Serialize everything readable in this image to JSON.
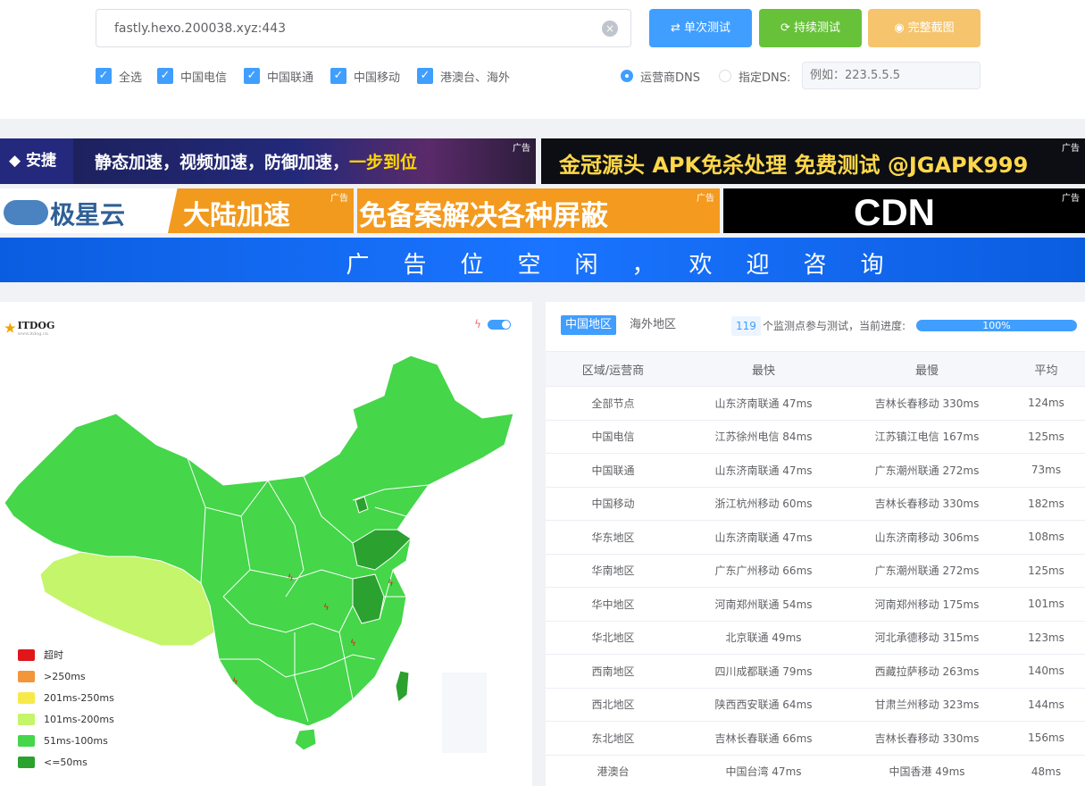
{
  "toolbar": {
    "url_value": "fastly.hexo.200038.xyz:443",
    "btn_single": "单次测试",
    "btn_continuous": "持续测试",
    "btn_screenshot": "完整截图"
  },
  "filters": {
    "all": "全选",
    "telecom": "中国电信",
    "unicom": "中国联通",
    "mobile": "中国移动",
    "overseas": "港澳台、海外"
  },
  "dns": {
    "isp_label": "运营商DNS",
    "custom_label": "指定DNS:",
    "placeholder": "例如：223.5.5.5"
  },
  "ads": {
    "tag": "广告",
    "ad1_logo": "安捷",
    "ad1_text": "静态加速，视频加速，防御加速，",
    "ad1_highlight": "一步到位",
    "ad2_text": "金冠源头 APK免杀处理 免费测试 @JGAPK999",
    "ad3_brand": "极星云",
    "ad3_text": "大陆加速",
    "ad4_text": "免备案解决各种屏蔽",
    "ad5_text": "CDN",
    "ad6_text": "广告位空闲，欢迎咨询"
  },
  "map": {
    "logo": "ITDOG",
    "logo_sub": "www.itdog.cn",
    "legend": [
      {
        "label": "超时",
        "color": "#e0161b"
      },
      {
        "label": ">250ms",
        "color": "#f3953a"
      },
      {
        "label": "201ms-250ms",
        "color": "#f8e94b"
      },
      {
        "label": "101ms-200ms",
        "color": "#c4f56a"
      },
      {
        "label": "51ms-100ms",
        "color": "#45d64a"
      },
      {
        "label": "<=50ms",
        "color": "#2ba12f"
      }
    ]
  },
  "results": {
    "tab_cn": "中国地区",
    "tab_overseas": "海外地区",
    "count": "119",
    "count_text": "个监测点参与测试，当前进度:",
    "progress": "100%",
    "headers": [
      "区域/运营商",
      "最快",
      "最慢",
      "平均"
    ],
    "rows": [
      [
        "全部节点",
        "山东济南联通 47ms",
        "吉林长春移动 330ms",
        "124ms"
      ],
      [
        "中国电信",
        "江苏徐州电信 84ms",
        "江苏镇江电信 167ms",
        "125ms"
      ],
      [
        "中国联通",
        "山东济南联通 47ms",
        "广东潮州联通 272ms",
        "73ms"
      ],
      [
        "中国移动",
        "浙江杭州移动 60ms",
        "吉林长春移动 330ms",
        "182ms"
      ],
      [
        "华东地区",
        "山东济南联通 47ms",
        "山东济南移动 306ms",
        "108ms"
      ],
      [
        "华南地区",
        "广东广州移动 66ms",
        "广东潮州联通 272ms",
        "125ms"
      ],
      [
        "华中地区",
        "河南郑州联通 54ms",
        "河南郑州移动 175ms",
        "101ms"
      ],
      [
        "华北地区",
        "北京联通 49ms",
        "河北承德移动 315ms",
        "123ms"
      ],
      [
        "西南地区",
        "四川成都联通 79ms",
        "西藏拉萨移动 263ms",
        "140ms"
      ],
      [
        "西北地区",
        "陕西西安联通 64ms",
        "甘肃兰州移动 323ms",
        "144ms"
      ],
      [
        "东北地区",
        "吉林长春联通 66ms",
        "吉林长春移动 330ms",
        "156ms"
      ],
      [
        "港澳台",
        "中国台湾 47ms",
        "中国香港 49ms",
        "48ms"
      ]
    ]
  }
}
